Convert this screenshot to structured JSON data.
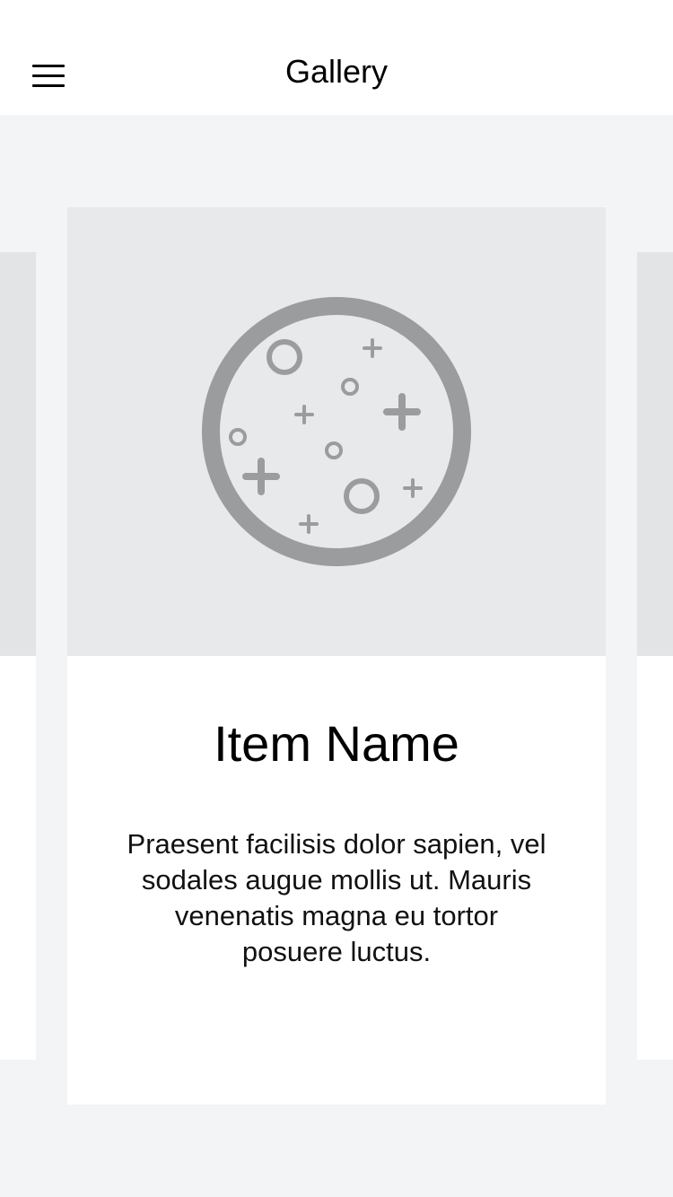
{
  "header": {
    "title": "Gallery",
    "menu_icon": "hamburger-menu-icon"
  },
  "card": {
    "image_icon": "moon-placeholder-icon",
    "item_name": "Item Name",
    "description": "Praesent facilisis dolor sapien, vel sodales augue mollis ut. Mauris venenatis magna eu tortor posuere luctus."
  },
  "colors": {
    "background": "#f3f4f6",
    "image_placeholder": "#e8e9eb",
    "icon_gray": "#9b9c9e",
    "text": "#000000"
  }
}
